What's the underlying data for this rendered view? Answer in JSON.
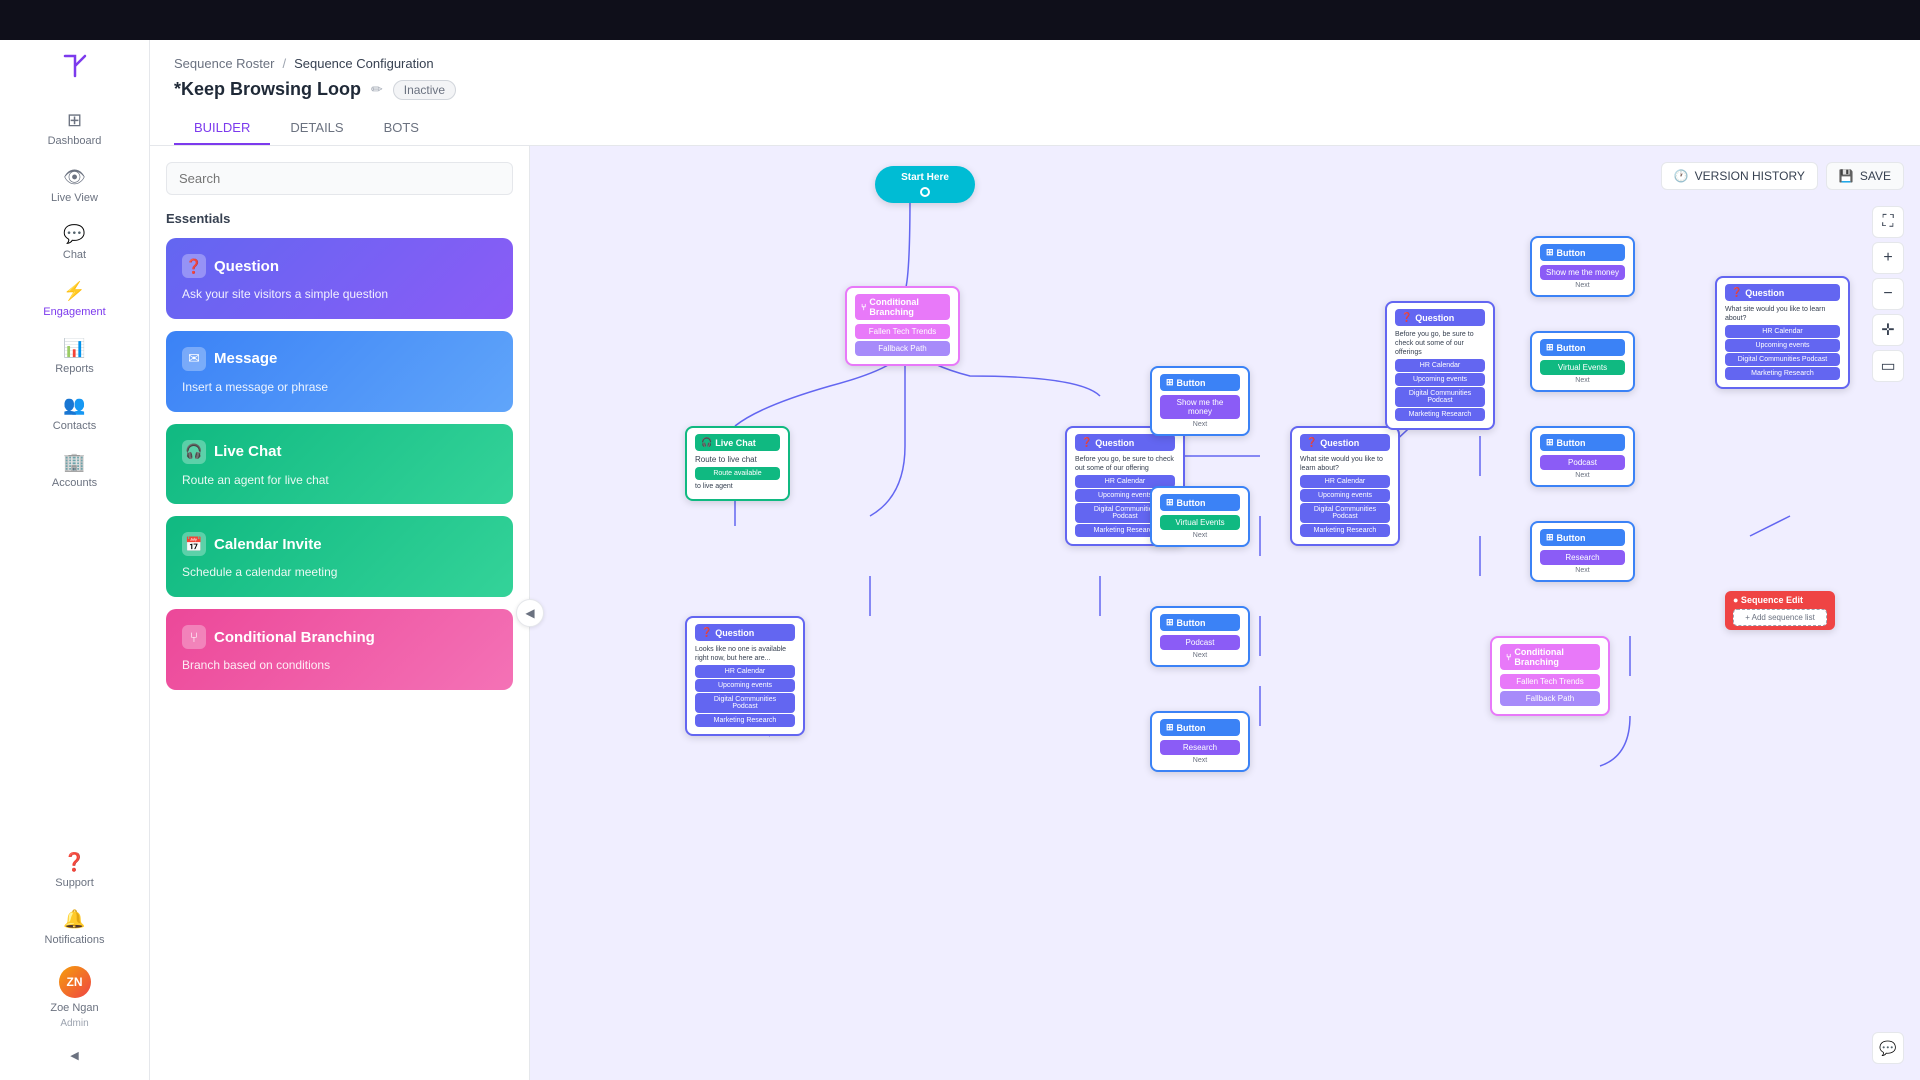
{
  "topbar": {},
  "sidebar": {
    "logo": "A",
    "items": [
      {
        "id": "dashboard",
        "label": "Dashboard",
        "icon": "⊞",
        "active": false
      },
      {
        "id": "live-view",
        "label": "Live View",
        "icon": "👁",
        "active": false
      },
      {
        "id": "chat",
        "label": "Chat",
        "icon": "💬",
        "active": false
      },
      {
        "id": "engagement",
        "label": "Engagement",
        "icon": "⚡",
        "active": false
      },
      {
        "id": "reports",
        "label": "Reports",
        "icon": "📊",
        "active": false
      },
      {
        "id": "contacts",
        "label": "Contacts",
        "icon": "👥",
        "active": false
      },
      {
        "id": "accounts",
        "label": "Accounts",
        "icon": "🏢",
        "active": false
      }
    ],
    "bottom_items": [
      {
        "id": "support",
        "label": "Support",
        "icon": "❓"
      },
      {
        "id": "notifications",
        "label": "Notifications",
        "icon": "🔔"
      }
    ],
    "user": {
      "name": "Zoe Ngan",
      "role": "Admin",
      "initials": "ZN"
    }
  },
  "breadcrumb": {
    "parent": "Sequence Roster",
    "separator": "/",
    "current": "Sequence Configuration"
  },
  "header": {
    "title": "*Keep Browsing Loop",
    "status": "Inactive"
  },
  "tabs": [
    {
      "id": "builder",
      "label": "BUILDER",
      "active": true
    },
    {
      "id": "details",
      "label": "DETAILS",
      "active": false
    },
    {
      "id": "bots",
      "label": "BOTS",
      "active": false
    }
  ],
  "toolbar": {
    "version_history": "VERSION HISTORY",
    "save": "SAVE"
  },
  "left_panel": {
    "search_placeholder": "Search",
    "section_title": "Essentials",
    "cards": [
      {
        "id": "question",
        "title": "Question",
        "description": "Ask your site visitors a simple question",
        "icon": "❓",
        "type": "question"
      },
      {
        "id": "message",
        "title": "Message",
        "description": "Insert a message or phrase",
        "icon": "✉",
        "type": "message"
      },
      {
        "id": "livechat",
        "title": "Live Chat",
        "description": "Route an agent for live chat",
        "icon": "🎧",
        "type": "livechat"
      },
      {
        "id": "calendar",
        "title": "Calendar Invite",
        "description": "Schedule a calendar meeting",
        "icon": "📅",
        "type": "calendar"
      },
      {
        "id": "conditional",
        "title": "Conditional Branching",
        "description": "Branch based on conditions",
        "icon": "⑂",
        "type": "conditional"
      }
    ]
  },
  "flow": {
    "start_label": "Start Here",
    "nodes": []
  }
}
